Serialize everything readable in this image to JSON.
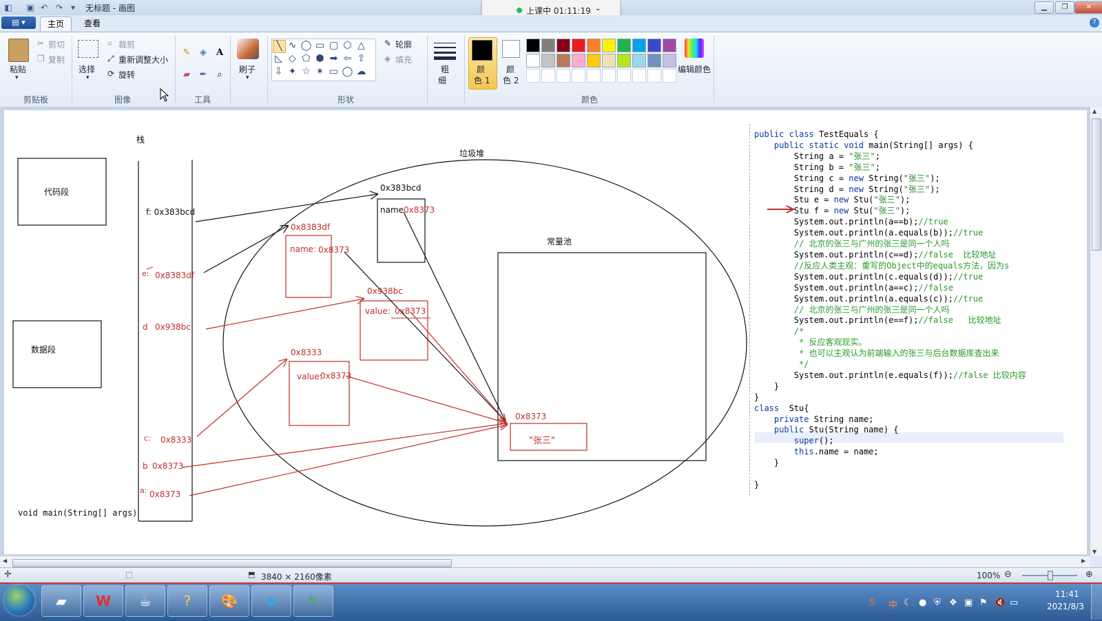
{
  "window": {
    "title": "无标题 - 画图",
    "class_status": "上课中 01:11:19"
  },
  "ribbon": {
    "tabs": [
      "主页",
      "查看"
    ],
    "clipboard": {
      "paste": "粘贴",
      "cut": "剪切",
      "copy": "复制",
      "group": "剪贴板"
    },
    "image": {
      "select": "选择",
      "crop": "裁剪",
      "resize": "重新调整大小",
      "rotate": "旋转",
      "group": "图像"
    },
    "tools": {
      "group": "工具"
    },
    "brush": {
      "label": "刷子"
    },
    "shapes": {
      "outline": "轮廓",
      "fill": "填充",
      "group": "形状"
    },
    "size": {
      "line1": "粗",
      "line2": "细"
    },
    "colors": {
      "color1_a": "颜",
      "color1_b": "色 1",
      "color2_a": "颜",
      "color2_b": "色 2",
      "edit": "编辑颜色",
      "group": "颜色",
      "palette_row1": [
        "#000000",
        "#7f7f7f",
        "#880015",
        "#ed1c24",
        "#ff7f27",
        "#fff200",
        "#22b14c",
        "#00a2e8",
        "#3f48cc",
        "#a349a4"
      ],
      "palette_row2": [
        "#ffffff",
        "#c3c3c3",
        "#b97a57",
        "#ffaec9",
        "#ffc90e",
        "#efe4b0",
        "#b5e61d",
        "#99d9ea",
        "#7092be",
        "#c8bfe7"
      ]
    }
  },
  "drawing": {
    "stack_title": "栈",
    "heap_title": "垃圾堆",
    "pool_title": "常量池",
    "code_segment": "代码段",
    "data_segment": "数据段",
    "main_sig": "void main(String[] args)",
    "stack_vars": {
      "f": "f: 0x383bcd",
      "e_label": "e:",
      "e_val": "0x8383df",
      "d_label": "d",
      "d_val": "0x938bc",
      "c_label": "c:",
      "c_val": "0x8333",
      "b_label": "b",
      "b_val": "0x8373",
      "a_label": "a:",
      "a_val": "0x8373"
    },
    "objects": {
      "f_addr": "0x383bcd",
      "f_field": "name",
      "f_field_val": "0x8373",
      "e_addr": "0x8383df",
      "e_field": "name:",
      "e_field_val": "0x8373",
      "d_addr": "0x938bc",
      "d_field": "value:",
      "d_field_val": "0x8373",
      "c_addr": "0x8333",
      "c_field": "value:",
      "c_field_val": "0x8373"
    },
    "pool": {
      "addr": "0x8373",
      "literal": "\"张三\""
    }
  },
  "code_lines": [
    {
      "t": "public class TestEquals {",
      "c": "kw"
    },
    {
      "t": "    public static void main(String[] args) {",
      "c": ""
    },
    {
      "t": "        String a = \"张三\";",
      "c": ""
    },
    {
      "t": "        String b = \"张三\";",
      "c": ""
    },
    {
      "t": "        String c = new String(\"张三\");",
      "c": ""
    },
    {
      "t": "        String d = new String(\"张三\");",
      "c": ""
    },
    {
      "t": "        Stu e = new Stu(\"张三\");",
      "c": ""
    },
    {
      "t": "        Stu f = new Stu(\"张三\");",
      "c": ""
    },
    {
      "t": "        System.out.println(a==b);//true",
      "c": ""
    },
    {
      "t": "        System.out.println(a.equals(b));//true",
      "c": ""
    },
    {
      "t": "        // 北京的张三与广州的张三是同一个人吗",
      "c": "cm"
    },
    {
      "t": "        System.out.println(c==d);//false  比较地址",
      "c": ""
    },
    {
      "t": "        //反应人类主观：重写的Object中的equals方法，因为s",
      "c": "cm"
    },
    {
      "t": "        System.out.println(c.equals(d));//true",
      "c": ""
    },
    {
      "t": "        System.out.println(a==c);//false",
      "c": ""
    },
    {
      "t": "        System.out.println(a.equals(c));//true",
      "c": ""
    },
    {
      "t": "        // 北京的张三与广州的张三是同一个人吗",
      "c": "cm"
    },
    {
      "t": "        System.out.println(e==f);//false   比较地址",
      "c": ""
    },
    {
      "t": "        /*",
      "c": "cm"
    },
    {
      "t": "         * 反应客观现实。",
      "c": "cm"
    },
    {
      "t": "         * 也可以主观认为前端输入的张三与后台数据库查出来",
      "c": "cm"
    },
    {
      "t": "         */",
      "c": "cm"
    },
    {
      "t": "        System.out.println(e.equals(f));//false 比较内容",
      "c": ""
    },
    {
      "t": "    }",
      "c": ""
    },
    {
      "t": "}",
      "c": ""
    },
    {
      "t": "class  Stu{",
      "c": "kw"
    },
    {
      "t": "    private String name;",
      "c": ""
    },
    {
      "t": "    public Stu(String name) {",
      "c": ""
    },
    {
      "t": "        super();",
      "c": ""
    },
    {
      "t": "        this.name = name;",
      "c": ""
    },
    {
      "t": "    }",
      "c": ""
    },
    {
      "t": "",
      "c": ""
    },
    {
      "t": "}",
      "c": ""
    }
  ],
  "status": {
    "canvas_size": "3840 × 2160像素",
    "zoom": "100%"
  },
  "taskbar": {
    "time": "11:41",
    "date": "2021/8/3",
    "tray_ime": "中"
  }
}
